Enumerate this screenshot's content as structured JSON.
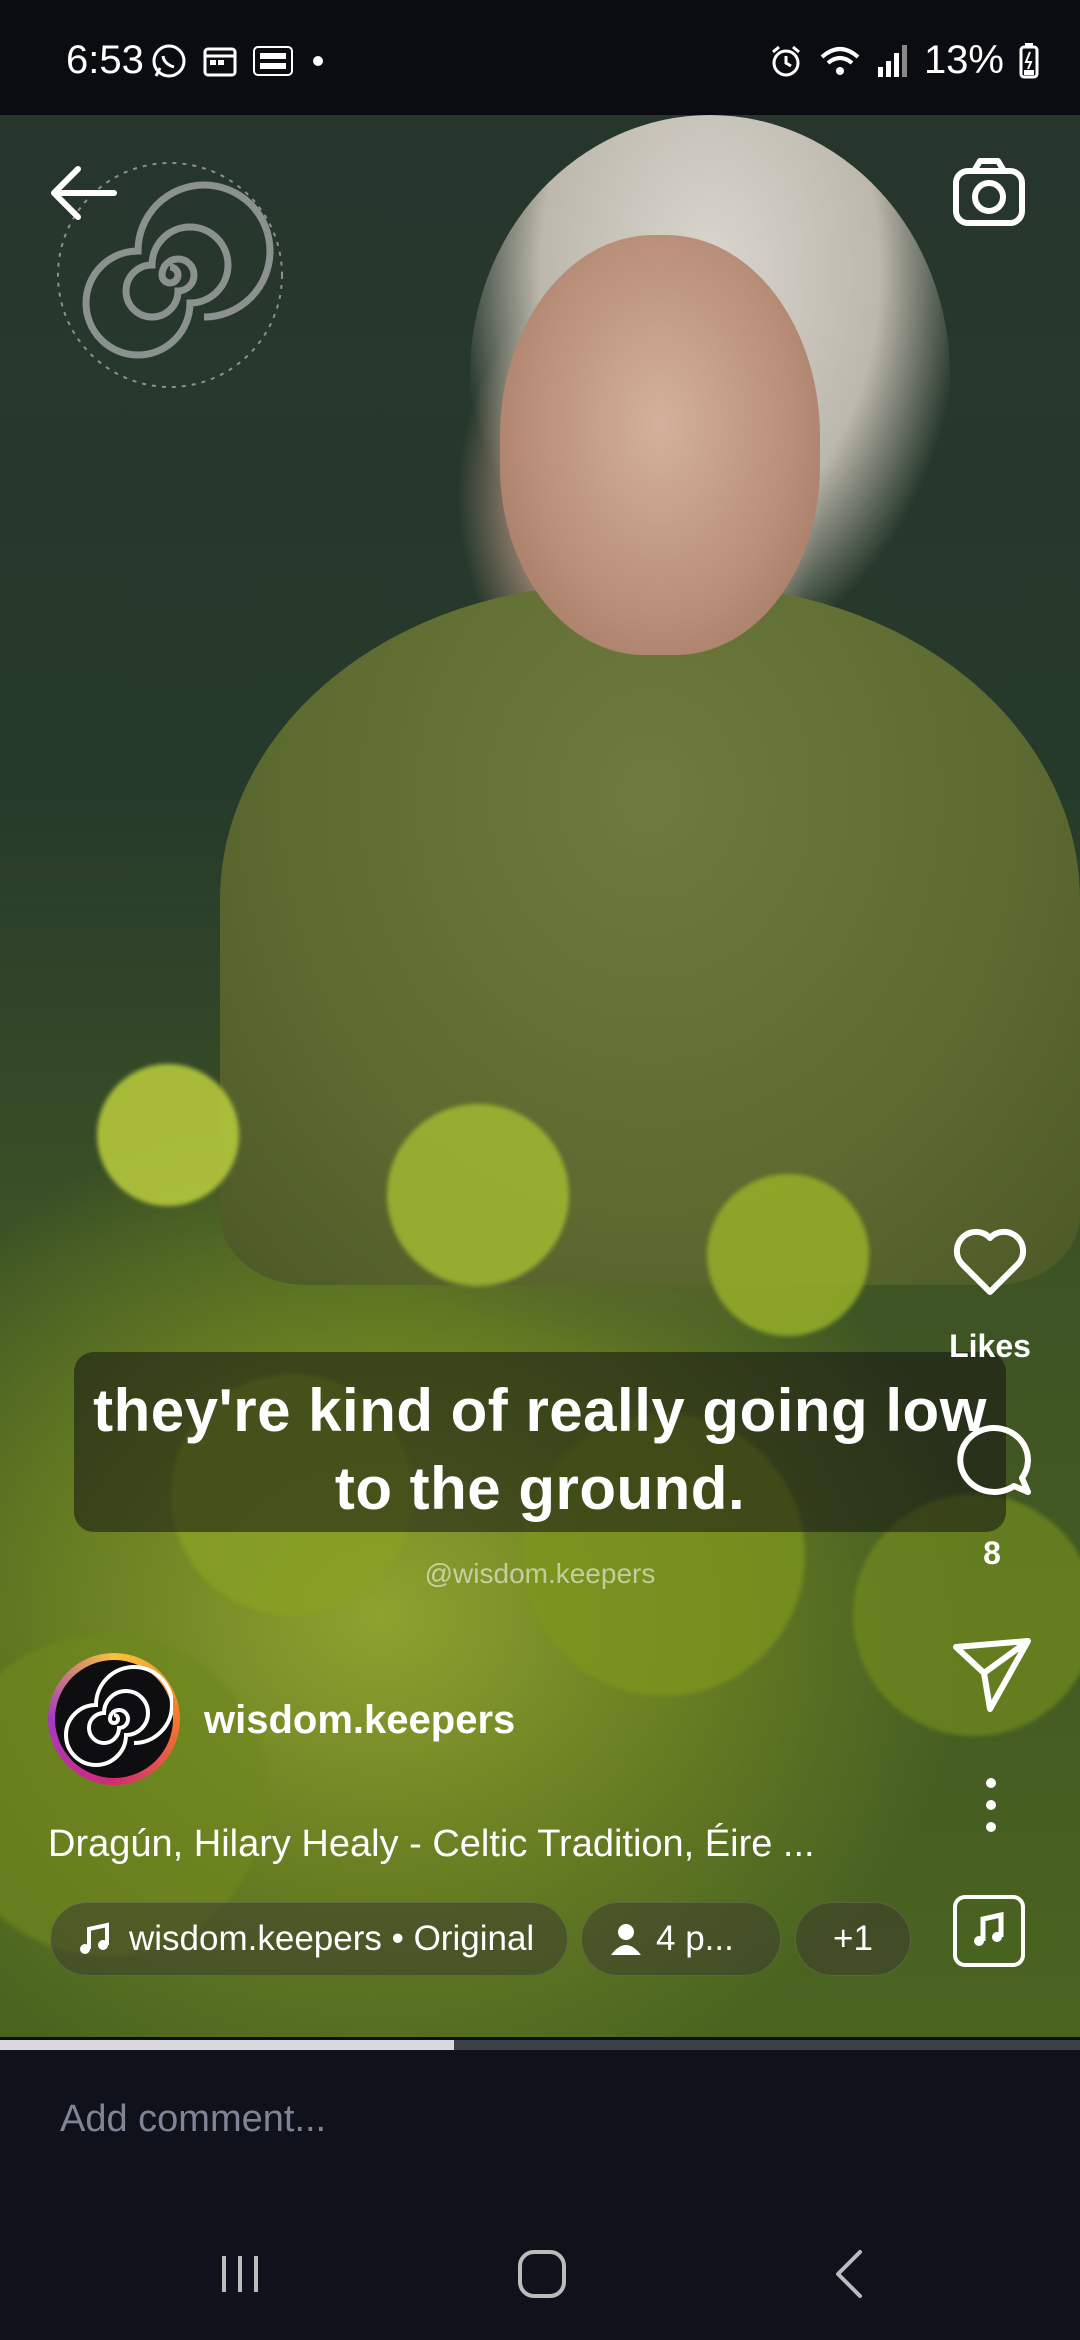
{
  "status_bar": {
    "time": "6:53",
    "battery": "13%",
    "left_icons": [
      "whatsapp-icon",
      "calendar-icon",
      "temu-icon",
      "dot-icon"
    ],
    "right_icons": [
      "alarm-icon",
      "wifi-icon",
      "signal-icon",
      "battery-charging-icon"
    ]
  },
  "video": {
    "caption": "they're kind of really going low to the ground.",
    "watermark_handle": "@wisdom.keepers",
    "progress": 0.42
  },
  "actions": {
    "like_label": "Likes",
    "comment_count": "8"
  },
  "post": {
    "username": "wisdom.keepers",
    "title": "Dragún, Hilary Healy - Celtic Tradition, Éire ...",
    "audio": "wisdom.keepers • Original",
    "people": "4 p...",
    "more": "+1"
  },
  "comment": {
    "placeholder": "Add comment..."
  },
  "colors": {
    "background": "#0d0f14",
    "avatar_ring": [
      "#f9c33a",
      "#f37a2a",
      "#d42a72",
      "#a43ac3"
    ]
  }
}
